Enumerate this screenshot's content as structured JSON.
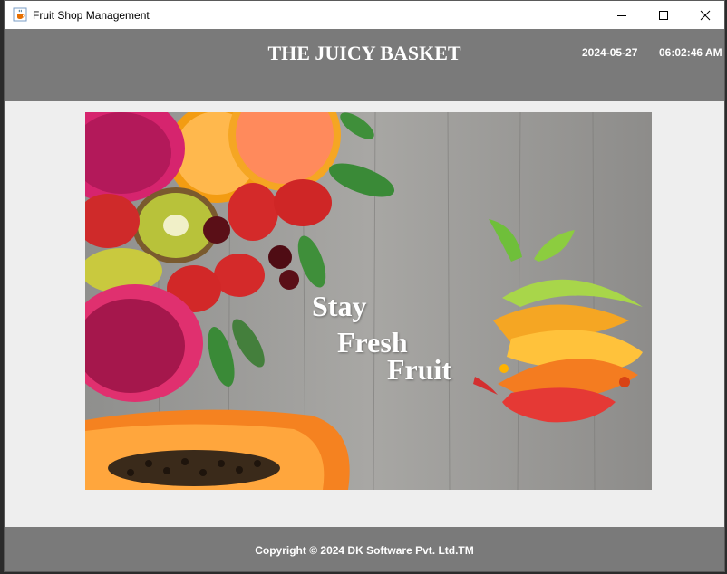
{
  "window": {
    "title": "Fruit Shop Management",
    "icons": {
      "app": "java-cup-icon",
      "minimize": "minimize-icon",
      "maximize": "maximize-icon",
      "close": "close-icon"
    }
  },
  "header": {
    "brand": "THE JUICY BASKET",
    "date": "2024-05-27",
    "time": "06:02:46 AM",
    "background": "#7a7a7a"
  },
  "banner": {
    "tagline": {
      "line1": "Stay",
      "line2": "Fresh",
      "line3": "Fruit"
    },
    "logo_icon": "fruit-logo-icon"
  },
  "footer": {
    "copyright": "Copyright  © 2024 DK Software Pvt. Ltd.TM"
  }
}
